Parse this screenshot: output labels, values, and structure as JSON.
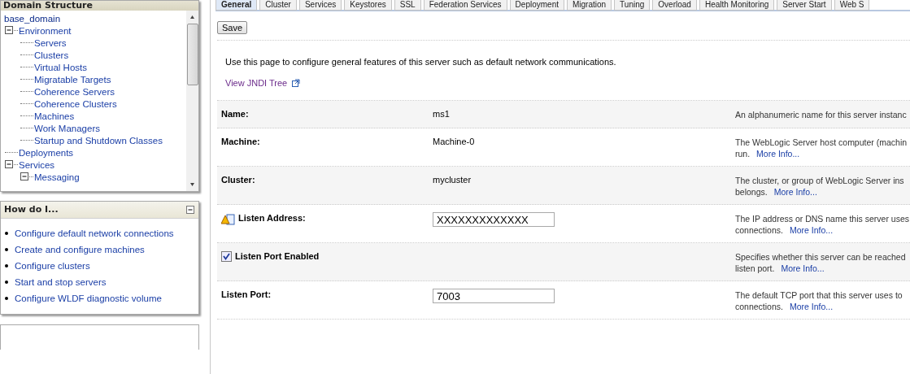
{
  "domain_structure": {
    "title": "Domain Structure",
    "tree": [
      {
        "label": "base_domain",
        "children": [
          {
            "label": "Environment",
            "expanded": true,
            "children": [
              {
                "label": "Servers"
              },
              {
                "label": "Clusters"
              },
              {
                "label": "Virtual Hosts"
              },
              {
                "label": "Migratable Targets"
              },
              {
                "label": "Coherence Servers"
              },
              {
                "label": "Coherence Clusters"
              },
              {
                "label": "Machines"
              },
              {
                "label": "Work Managers"
              },
              {
                "label": "Startup and Shutdown Classes"
              }
            ]
          },
          {
            "label": "Deployments"
          },
          {
            "label": "Services",
            "expanded": true,
            "children": [
              {
                "label": "Messaging",
                "expanded": true
              }
            ]
          }
        ]
      }
    ]
  },
  "how_do_i": {
    "title": "How do I...",
    "expanded": true,
    "links": [
      "Configure default network connections",
      "Create and configure machines",
      "Configure clusters",
      "Start and stop servers",
      "Configure WLDF diagnostic volume"
    ]
  },
  "tabs": [
    {
      "label": "General",
      "selected": true
    },
    {
      "label": "Cluster",
      "selected": false
    },
    {
      "label": "Services",
      "selected": false
    },
    {
      "label": "Keystores",
      "selected": false
    },
    {
      "label": "SSL",
      "selected": false
    },
    {
      "label": "Federation Services",
      "selected": false
    },
    {
      "label": "Deployment",
      "selected": false
    },
    {
      "label": "Migration",
      "selected": false
    },
    {
      "label": "Tuning",
      "selected": false
    },
    {
      "label": "Overload",
      "selected": false
    },
    {
      "label": "Health Monitoring",
      "selected": false
    },
    {
      "label": "Server Start",
      "selected": false
    },
    {
      "label": "Web S",
      "selected": false
    }
  ],
  "save_button": "Save",
  "intro": "Use this page to configure general features of this server such as default network communications.",
  "jndi_link": "View JNDI Tree",
  "fields": [
    {
      "kind": "text",
      "label": "Name:",
      "value": "ms1",
      "description": "An alphanumeric name for this server instanc"
    },
    {
      "kind": "text",
      "label": "Machine:",
      "value": "Machine-0",
      "description": "The WebLogic Server host computer (machin",
      "description_end": "run.",
      "more_info": "More Info..."
    },
    {
      "kind": "text",
      "label": "Cluster:",
      "value": "mycluster",
      "description": "The cluster, or group of WebLogic Server ins",
      "description_end": "belongs.",
      "more_info": "More Info..."
    },
    {
      "kind": "input",
      "warning": true,
      "label": "Listen Address:",
      "value": "XXXXXXXXXXXXX",
      "description": "The IP address or DNS name this server uses",
      "description_end": "connections.",
      "more_info": "More Info..."
    },
    {
      "kind": "checkbox",
      "checked": true,
      "label": "Listen Port Enabled",
      "description": "Specifies whether this server can be reached",
      "description_end": "listen port.",
      "more_info": "More Info..."
    },
    {
      "kind": "input",
      "label": "Listen Port:",
      "value": "7003",
      "description": "The default TCP port that this server uses to",
      "description_end": "connections.",
      "more_info": "More Info..."
    }
  ]
}
